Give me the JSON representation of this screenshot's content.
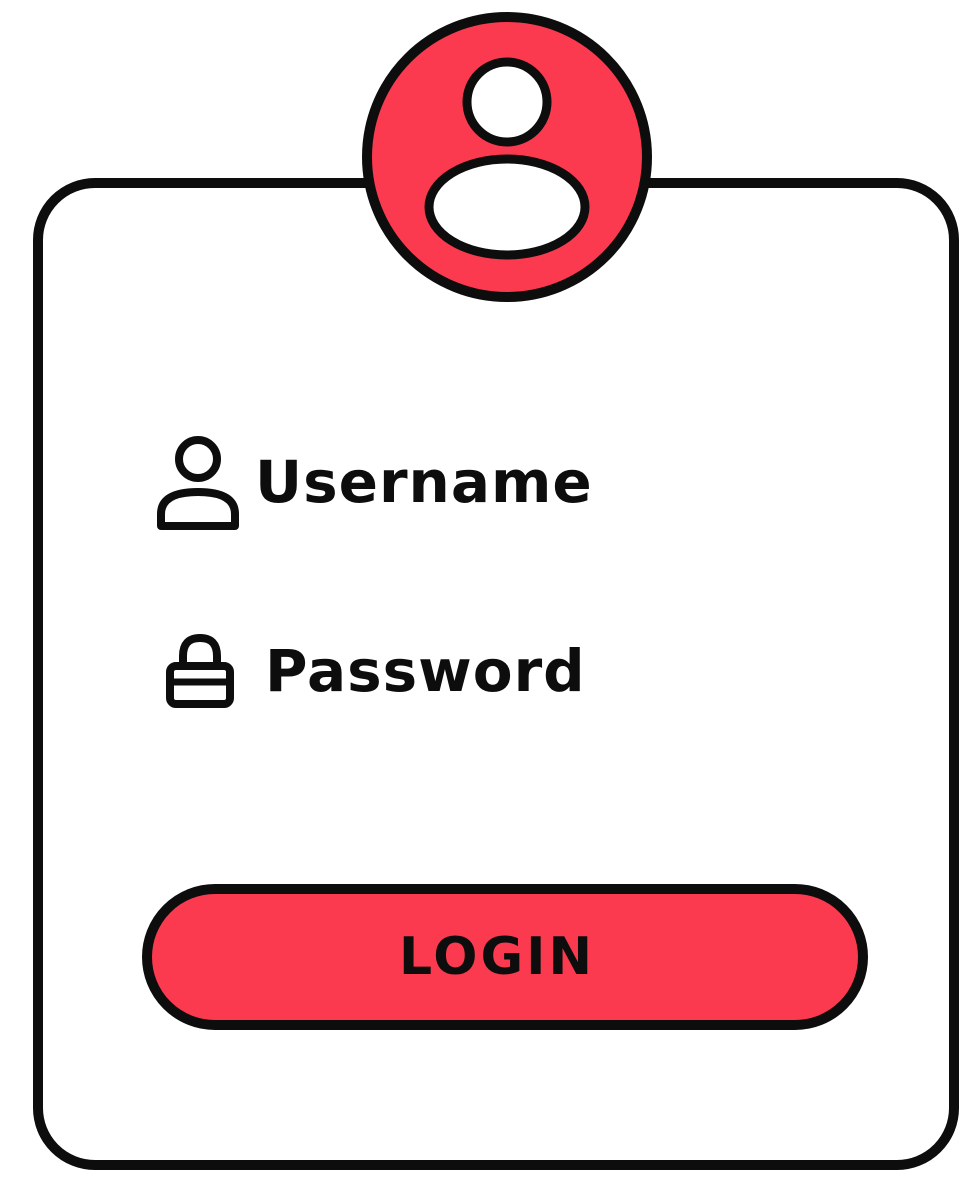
{
  "form": {
    "username_label": "Username",
    "password_label": "Password",
    "login_label": "LOGIN"
  },
  "icons": {
    "avatar": "user-avatar-icon",
    "username": "user-icon",
    "password": "lock-icon"
  },
  "colors": {
    "accent": "#fb3a4f",
    "outline": "#0d0d0d",
    "background": "#ffffff"
  }
}
